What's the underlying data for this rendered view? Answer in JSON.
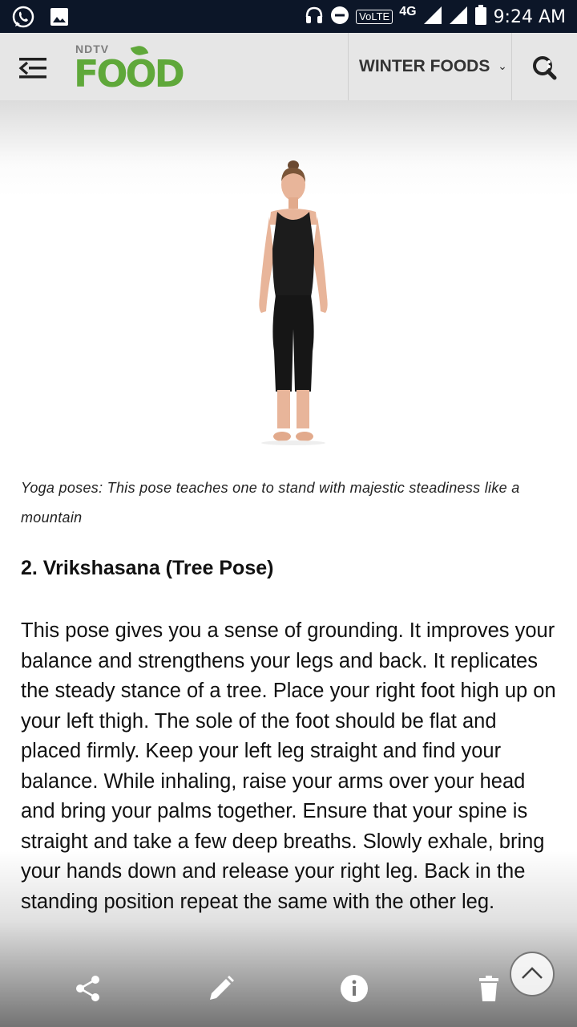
{
  "status_bar": {
    "time": "9:24 AM",
    "volte": "VoLTE",
    "network": "4G"
  },
  "header": {
    "logo_top": "NDTV",
    "logo_main": "FOOD",
    "nav_label": "WINTER FOODS",
    "nav_chevron": "⌄"
  },
  "article": {
    "caption": "Yoga poses: This pose teaches one to stand with majestic steadiness like a mountain",
    "heading": "2. Vrikshasana (Tree Pose)",
    "paragraph": "This pose gives you a sense of grounding. It improves your balance and strengthens your legs and back. It replicates the steady stance of a tree. Place your right foot high up on your left thigh. The sole of the foot should be flat and placed firmly. Keep your left leg straight and find your balance. While inhaling, raise your arms over your head and bring your palms together. Ensure that your spine is straight and take a few deep breaths. Slowly exhale, bring your hands down and release your right leg. Back in the standing position repeat the same with the other leg."
  },
  "icons": {
    "status_left": [
      "whatsapp-icon",
      "image-icon"
    ],
    "status_right": [
      "headphones-icon",
      "do-not-disturb-icon",
      "signal-icon",
      "signal-icon",
      "battery-icon"
    ],
    "header": [
      "menu-icon",
      "search-icon"
    ],
    "toolbar": [
      "share-icon",
      "edit-icon",
      "info-icon",
      "delete-icon",
      "chevron-up-icon"
    ]
  },
  "colors": {
    "status_bar": "#0c1628",
    "header_bg": "#e6e6e6",
    "logo_green": "#5fa83a"
  }
}
